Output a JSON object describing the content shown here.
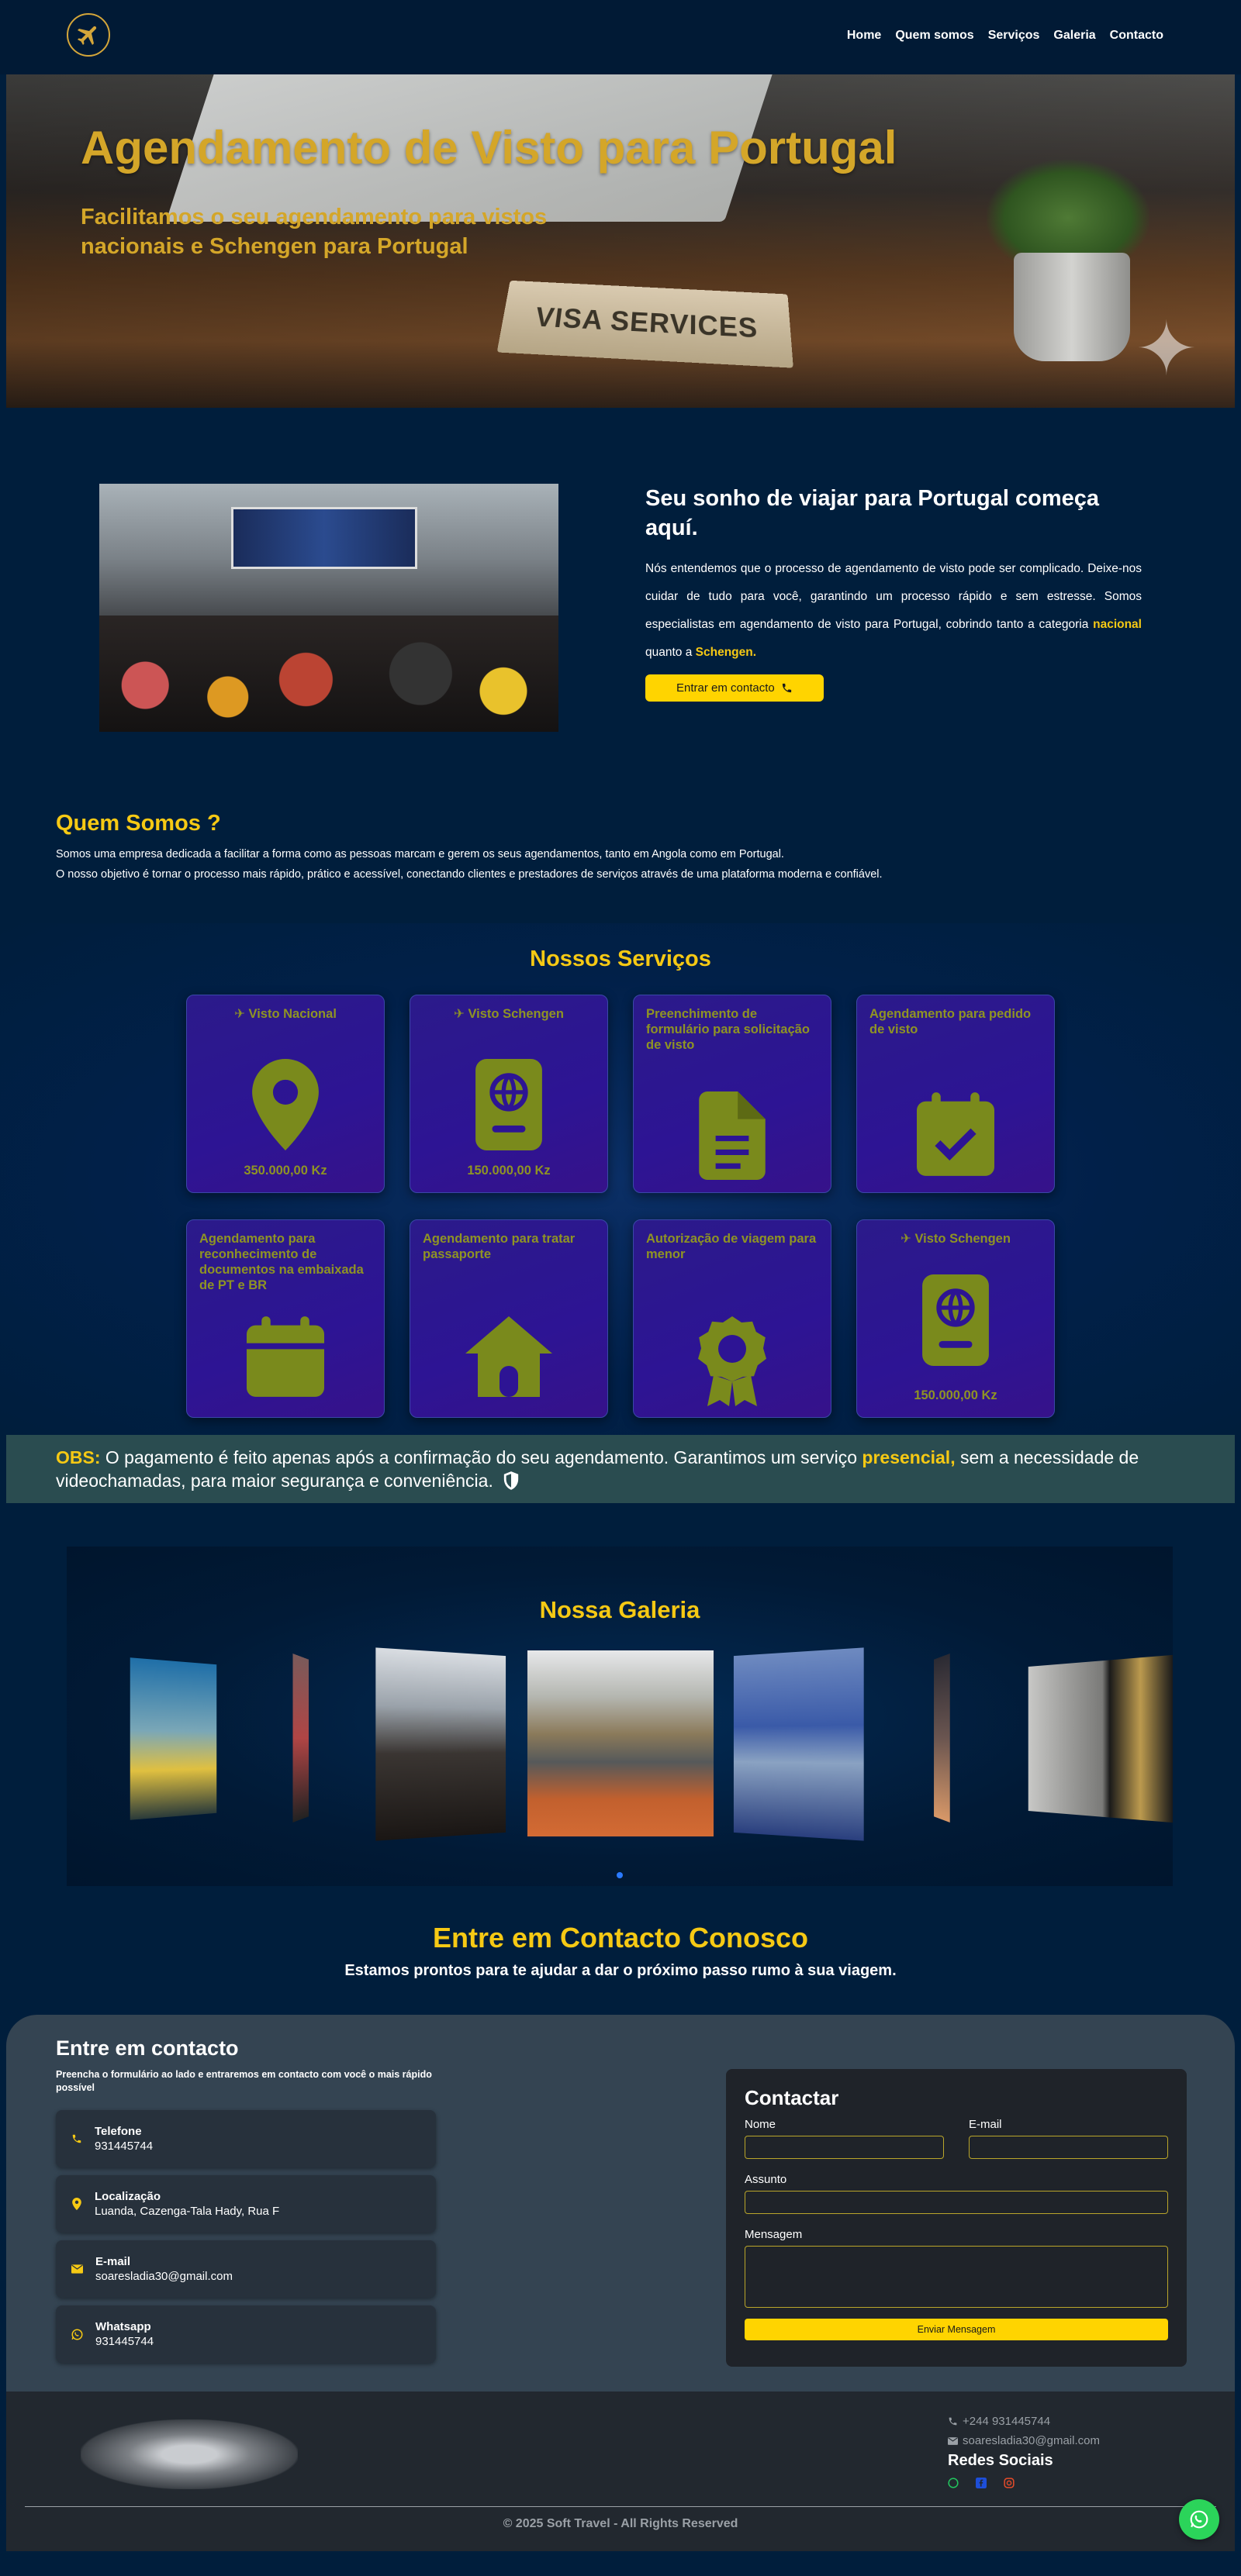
{
  "nav": {
    "links": [
      "Home",
      "Quem somos",
      "Serviços",
      "Galeria",
      "Contacto"
    ]
  },
  "hero": {
    "title": "Agendamento de Visto para Portugal",
    "subtitle": "Facilitamos o seu agendamento para vistos nacionais e Schengen para Portugal",
    "sign_text": "VISA SERVICES"
  },
  "intro": {
    "heading": "Seu sonho de viajar para Portugal começa aquí.",
    "paragraph_start": "Nós entendemos que o processo de agendamento de visto pode ser complicado. Deixe-nos cuidar de tudo para você, garantindo um processo rápido e sem estresse. Somos especialistas em agendamento de visto para Portugal, cobrindo tanto a categoria ",
    "hl_nacional": "nacional",
    "paragraph_mid": " quanto a ",
    "hl_schengen": "Schengen.",
    "button": "Entrar em contacto"
  },
  "about": {
    "heading": "Quem Somos ?",
    "line1": "Somos uma empresa dedicada a facilitar a forma como as pessoas marcam e gerem os seus agendamentos, tanto em Angola como em Portugal.",
    "line2": "O nosso objetivo é tornar o processo mais rápido, prático e acessível, conectando clientes e prestadores de serviços através de uma plataforma moderna e confiável."
  },
  "services": {
    "heading": "Nossos Serviços",
    "cards": [
      {
        "title": "✈ Visto Nacional",
        "price": "350.000,00 Kz",
        "icon": "map-pin-icon"
      },
      {
        "title": "✈ Visto Schengen",
        "price": "150.000,00 Kz",
        "icon": "passport-icon"
      },
      {
        "title": "Preenchimento de formulário para solicitação de visto",
        "price": "",
        "icon": "document-icon"
      },
      {
        "title": "Agendamento para pedido de visto",
        "price": "",
        "icon": "calendar-check-icon"
      },
      {
        "title": "Agendamento para reconhecimento de documentos na embaixada de PT e BR",
        "price": "",
        "icon": "calendar-icon"
      },
      {
        "title": "Agendamento para tratar passaporte",
        "price": "",
        "icon": "house-icon"
      },
      {
        "title": "Autorização de viagem para menor",
        "price": "",
        "icon": "award-icon"
      },
      {
        "title": "✈ Visto Schengen",
        "price": "150.000,00 Kz",
        "icon": "passport-icon"
      }
    ]
  },
  "obs": {
    "label": "OBS:",
    "text1": " O pagamento é feito apenas após a confirmação do seu agendamento. Garantimos um serviço ",
    "highlight": "presencial,",
    "text2": " sem a necessidade de videochamadas, para maior segurança e conveniência."
  },
  "gallery": {
    "heading": "Nossa Galeria"
  },
  "contact_head": {
    "title": "Entre em Contacto Conosco",
    "subtitle": "Estamos prontos para te ajudar a dar o próximo passo rumo à sua viagem."
  },
  "contact": {
    "heading": "Entre em contacto",
    "sub": "Preencha o formulário ao lado e entraremos em contacto com você o mais rápido possível",
    "items": [
      {
        "label": "Telefone",
        "value": "931445744",
        "icon": "phone-icon"
      },
      {
        "label": "Localização",
        "value": "Luanda, Cazenga-Tala Hady, Rua F",
        "icon": "location-icon"
      },
      {
        "label": "E-mail",
        "value": "soaresladia30@gmail.com",
        "icon": "email-icon"
      },
      {
        "label": "Whatsapp",
        "value": "931445744",
        "icon": "whatsapp-icon"
      }
    ],
    "form": {
      "title": "Contactar",
      "name_label": "Nome",
      "email_label": "E-mail",
      "subject_label": "Assunto",
      "message_label": "Mensagem",
      "send": "Enviar Mensagem"
    }
  },
  "footer": {
    "phone": "+244 931445744",
    "email": "soaresladia30@gmail.com",
    "social_heading": "Redes Sociais",
    "copyright": "© 2025 Soft Travel - All Rights Reserved"
  },
  "colors": {
    "accent": "#f6c914",
    "navy": "#001e3c",
    "card_text": "#8f9423"
  }
}
